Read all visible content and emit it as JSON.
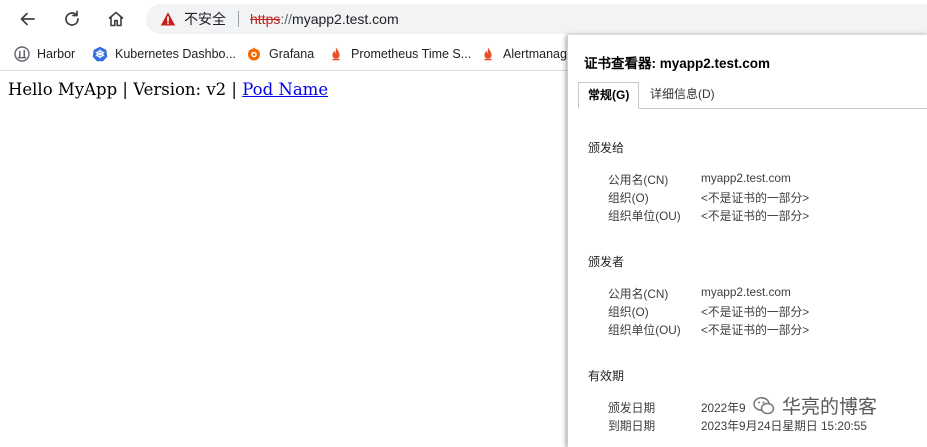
{
  "toolbar": {
    "security_label": "不安全",
    "url_scheme": "https",
    "url_separator": "://",
    "url_host": "myapp2.test.com"
  },
  "bookmarks": [
    {
      "label": "Harbor",
      "icon": "harbor-icon"
    },
    {
      "label": "Kubernetes Dashbo...",
      "icon": "kubernetes-icon"
    },
    {
      "label": "Grafana",
      "icon": "grafana-icon"
    },
    {
      "label": "Prometheus Time S...",
      "icon": "prometheus-icon"
    },
    {
      "label": "Alertmanage",
      "icon": "prometheus-icon"
    }
  ],
  "page": {
    "text": "Hello MyApp | Version: v2 |",
    "link": "Pod Name"
  },
  "dialog": {
    "title": "证书查看器: myapp2.test.com",
    "tabs": [
      "常规(G)",
      "详细信息(D)"
    ],
    "issued_to": {
      "title": "颁发给",
      "fields": [
        {
          "label": "公用名(CN)",
          "value": "myapp2.test.com"
        },
        {
          "label": "组织(O)",
          "value": "<不是证书的一部分>"
        },
        {
          "label": "组织单位(OU)",
          "value": "<不是证书的一部分>"
        }
      ]
    },
    "issued_by": {
      "title": "颁发者",
      "fields": [
        {
          "label": "公用名(CN)",
          "value": "myapp2.test.com"
        },
        {
          "label": "组织(O)",
          "value": "<不是证书的一部分>"
        },
        {
          "label": "组织单位(OU)",
          "value": "<不是证书的一部分>"
        }
      ]
    },
    "validity": {
      "title": "有效期",
      "fields": [
        {
          "label": "颁发日期",
          "value": "2022年9"
        },
        {
          "label": "到期日期",
          "value": "2023年9月24日星期日 15:20:55"
        }
      ]
    }
  },
  "watermark": {
    "text": "华亮的博客"
  },
  "colors": {
    "warning_red": "#c5221f",
    "link_blue": "#0000ee",
    "omnibox_bg": "#f1f3f4"
  }
}
